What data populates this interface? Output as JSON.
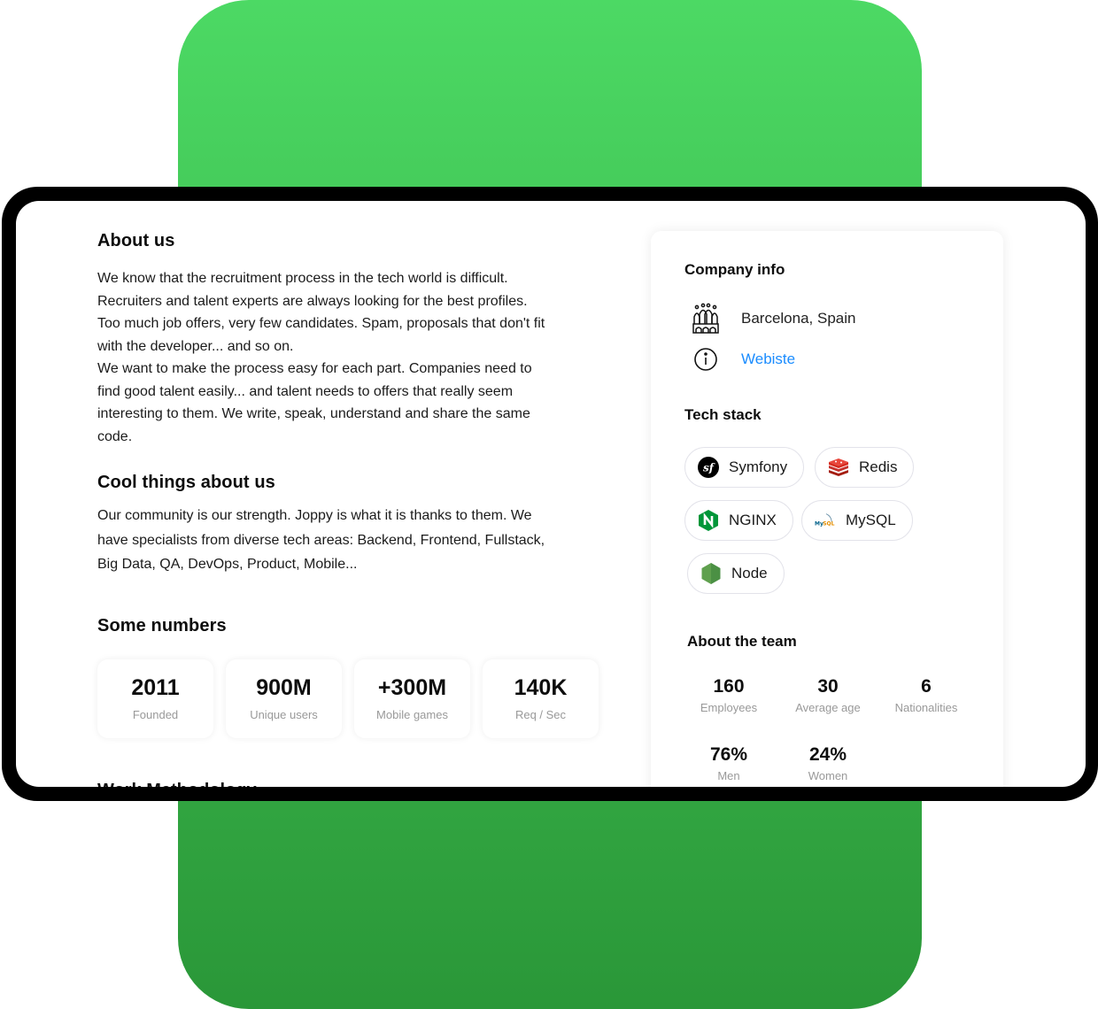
{
  "about": {
    "title": "About us",
    "paragraph_lines": [
      "We know that the recruitment process in the tech world is difficult.",
      "Recruiters and talent experts are always looking for the best profiles.",
      "Too much job offers, very few candidates. Spam, proposals that don't fit",
      "with the developer... and so on.",
      "We want to make the process easy for each part. Companies need to",
      "find good talent easily... and talent needs to offers that really seem",
      "interesting to them. We write, speak, understand and share the same",
      "code."
    ]
  },
  "cool": {
    "title": "Cool things about us",
    "paragraph_lines": [
      "Our community is our strength. Joppy is what it is thanks to them. We",
      "have specialists from diverse tech areas: Backend, Frontend, Fullstack,",
      "Big Data, QA, DevOps, Product, Mobile..."
    ]
  },
  "numbers": {
    "title": "Some numbers",
    "items": [
      {
        "value": "2011",
        "label": "Founded"
      },
      {
        "value": "900M",
        "label": "Unique users"
      },
      {
        "value": "+300M",
        "label": "Mobile games"
      },
      {
        "value": "140K",
        "label": "Req / Sec"
      }
    ]
  },
  "next_section": {
    "title": "Work Methodology"
  },
  "company_info": {
    "title": "Company info",
    "location": {
      "icon": "sagrada-familia-icon",
      "text": "Barcelona, Spain"
    },
    "website": {
      "icon": "info-icon",
      "text": "Webiste"
    }
  },
  "tech_stack": {
    "title": "Tech stack",
    "items": [
      {
        "name": "Symfony",
        "icon": "symfony-logo"
      },
      {
        "name": "Redis",
        "icon": "redis-logo"
      },
      {
        "name": "NGINX",
        "icon": "nginx-logo"
      },
      {
        "name": "MySQL",
        "icon": "mysql-logo"
      },
      {
        "name": "Node",
        "icon": "nodejs-logo"
      }
    ]
  },
  "team": {
    "title": "About the team",
    "items": [
      {
        "value": "160",
        "label": "Employees"
      },
      {
        "value": "30",
        "label": "Average age"
      },
      {
        "value": "6",
        "label": "Nationalities"
      },
      {
        "value": "76%",
        "label": "Men"
      },
      {
        "value": "24%",
        "label": "Women"
      }
    ]
  },
  "colors": {
    "accent_green": "#4cd964",
    "link_blue": "#1a8cff",
    "device_frame": "#000000"
  }
}
